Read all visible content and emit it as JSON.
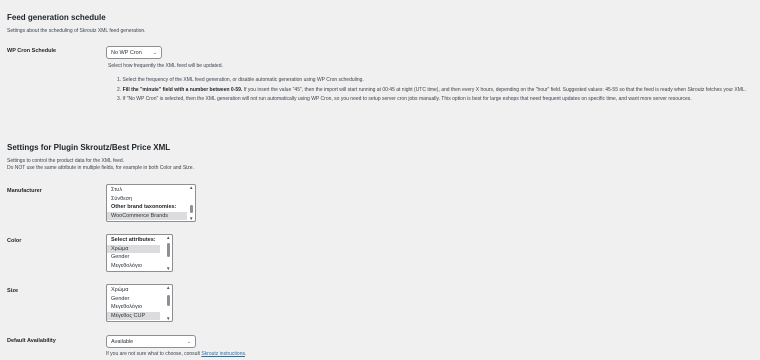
{
  "schedule": {
    "heading": "Feed generation schedule",
    "intro": "Settings about the scheduling of Skroutz XML feed generation.",
    "cron_label": "WP Cron Schedule",
    "cron_value": "No WP Cron",
    "cron_help": "Select how frequently the XML feed will be updated.",
    "steps": [
      "1. Select the frequency of the XML feed generation, or disable automatic generation using WP Cron scheduling.",
      "2.",
      "3. If \"No WP Cron\" is selected, then the XML generation will not run automatically using WP Cron, so you need to setup server cron jobs manually. This option is best for large eshops that need frequent updates on specific time, and want more server resources."
    ],
    "step2_bold": "Fill the \"minute\" field with a number between 0-59.",
    "step2_rest": " If you insert the value \"45\", then the import will start running at 00:45 at night (UTC time), and then every X hours, depending on the \"hour\" field. Suggested values: 45-55 so that the feed is ready when Skroutz fetches your XML."
  },
  "plugin": {
    "heading": "Settings for Plugin Skroutz/Best Price XML",
    "intro_1": "Settings to control the product data for the XML feed.",
    "intro_2": "Do NOT use the same attribute in multiple fields, for example in both Color and Size.",
    "manufacturer": {
      "label": "Manufacturer",
      "options": [
        {
          "text": "Στυλ",
          "group": false,
          "selected": false
        },
        {
          "text": "Σύνθεση",
          "group": false,
          "selected": false
        },
        {
          "text": "Other brand taxonomies:",
          "group": true,
          "selected": false
        },
        {
          "text": "WooCommerce Brands",
          "group": false,
          "selected": true
        }
      ]
    },
    "color": {
      "label": "Color",
      "options": [
        {
          "text": "Select attributes:",
          "group": true,
          "selected": false
        },
        {
          "text": "Χρώμα",
          "group": false,
          "selected": true
        },
        {
          "text": "Gender",
          "group": false,
          "selected": false
        },
        {
          "text": "Μεγεθολόγιο",
          "group": false,
          "selected": false
        }
      ]
    },
    "size": {
      "label": "Size",
      "options": [
        {
          "text": "Χρώμα",
          "group": false,
          "selected": false
        },
        {
          "text": "Gender",
          "group": false,
          "selected": false
        },
        {
          "text": "Μεγεθολόγιο",
          "group": false,
          "selected": false
        },
        {
          "text": "Μέγεθος CUP",
          "group": false,
          "selected": true
        }
      ]
    },
    "availability": {
      "label": "Default Availability",
      "value": "Available",
      "help_prefix": "If you are not sure what to choose, consult ",
      "help_link": "Skroutz instructions",
      "help_suffix": "."
    }
  }
}
